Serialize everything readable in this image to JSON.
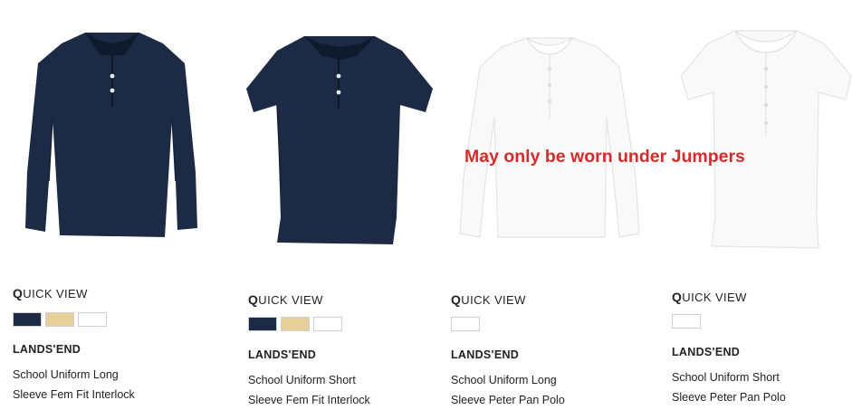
{
  "note": "May only be worn under Jumpers",
  "quick_view": {
    "q": "Q",
    "rest": "UICK VIEW"
  },
  "colors": {
    "navy": "#1c2a44",
    "khaki": "#e6cf98",
    "white": "#ffffff",
    "note_red": "#d62b2b"
  },
  "products": [
    {
      "brand": "LANDS'END",
      "title_line1": "School Uniform Long",
      "title_line2": "Sleeve Fem Fit Interlock",
      "swatches": [
        "navy",
        "khaki",
        "white"
      ],
      "garment": "navy-long-sleeve-polo"
    },
    {
      "brand": "LANDS'END",
      "title_line1": "School Uniform Short",
      "title_line2": "Sleeve Fem Fit Interlock",
      "swatches": [
        "navy",
        "khaki",
        "white"
      ],
      "garment": "navy-short-sleeve-polo"
    },
    {
      "brand": "LANDS'END",
      "title_line1": "School Uniform Long",
      "title_line2": "Sleeve Peter Pan Polo",
      "swatches": [
        "white"
      ],
      "garment": "white-long-sleeve-peter-pan-polo"
    },
    {
      "brand": "LANDS'END",
      "title_line1": "School Uniform Short",
      "title_line2": "Sleeve Peter Pan Polo",
      "swatches": [
        "white"
      ],
      "garment": "white-short-sleeve-peter-pan-polo"
    }
  ]
}
